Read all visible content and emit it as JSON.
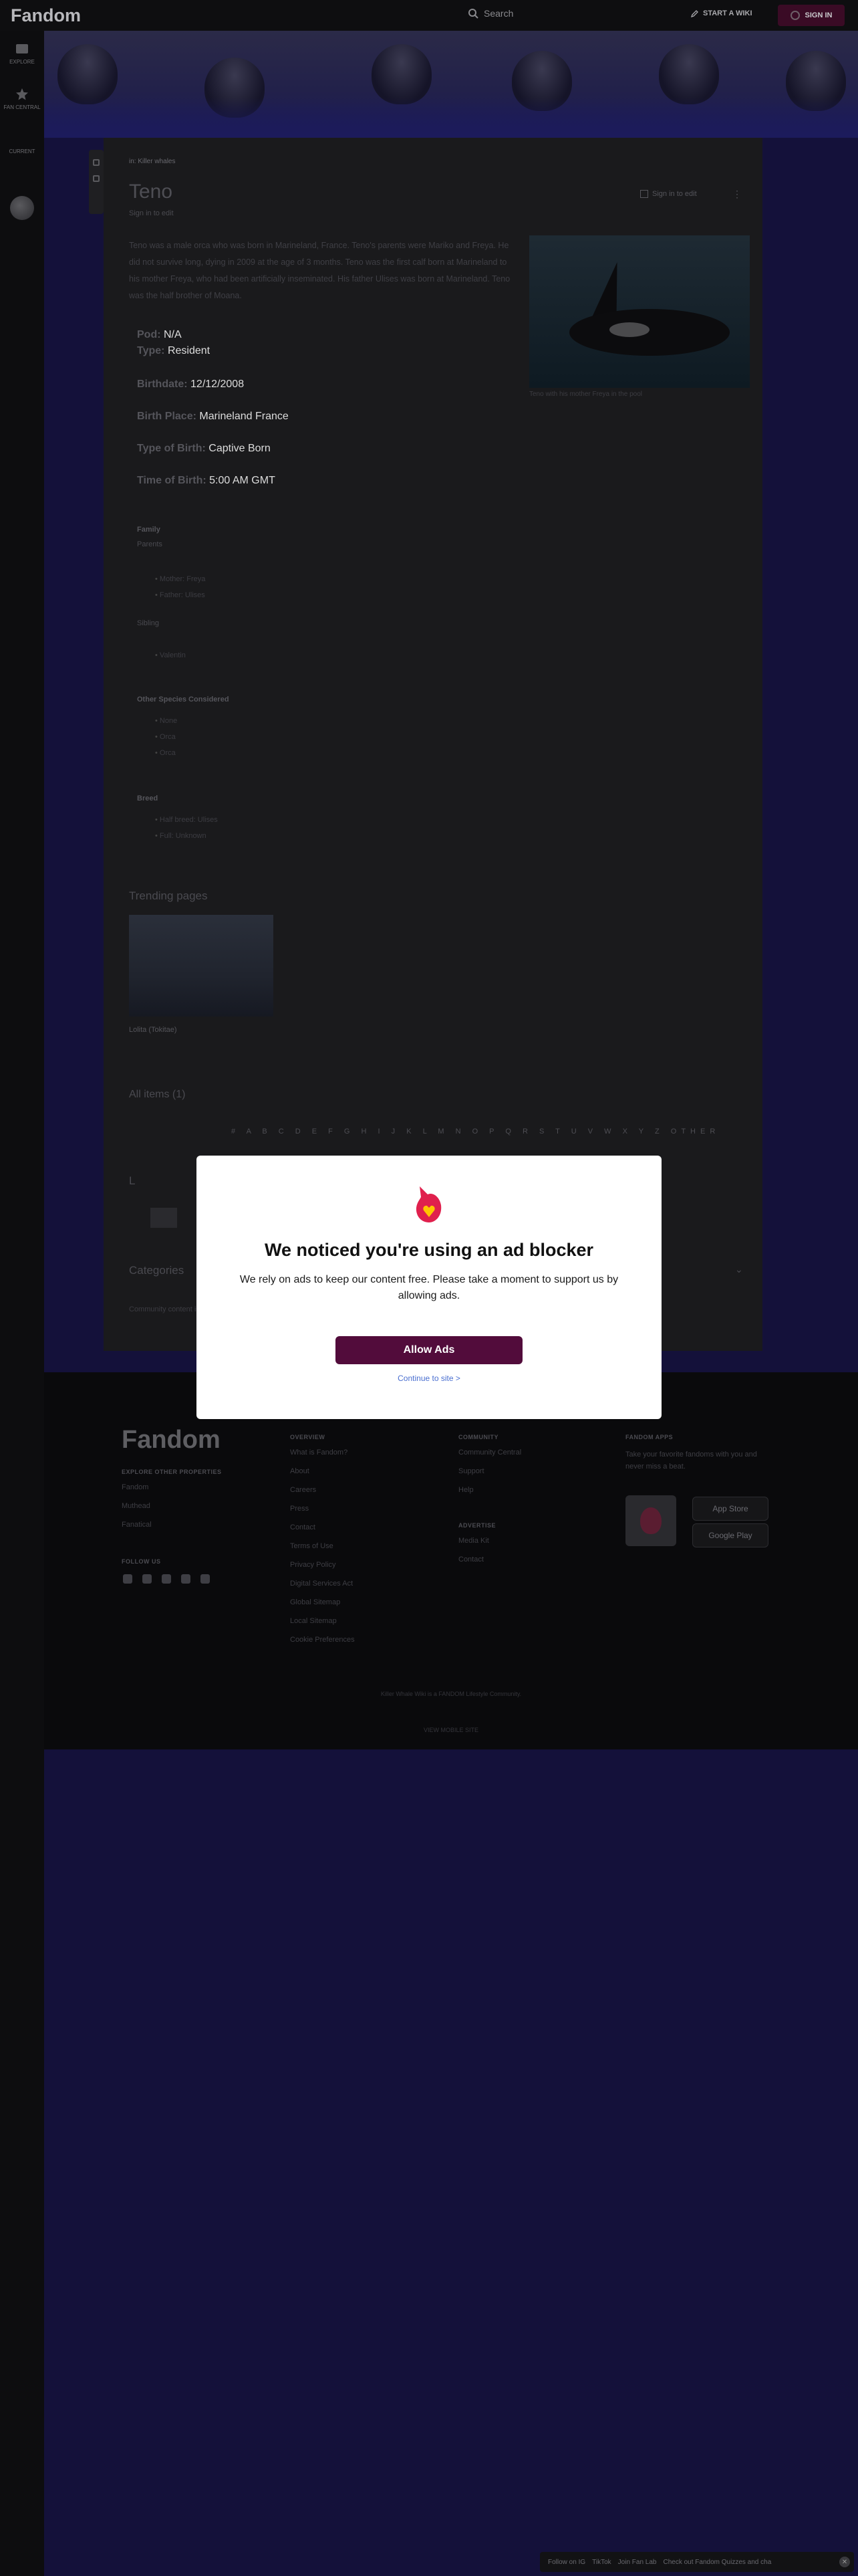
{
  "topbar": {
    "logo_text": "Fandom",
    "search_label": "Search",
    "start_wiki": "START A WIKI",
    "sign_in": "SIGN IN"
  },
  "rail": {
    "items": [
      {
        "label": "EXPLORE",
        "icon": "compass-icon"
      },
      {
        "label": "FAN CENTRAL",
        "icon": "star-icon"
      },
      {
        "label": "CURRENT",
        "icon": "avatar"
      }
    ]
  },
  "article": {
    "breadcrumb": "in: Killer whales",
    "title": "Teno",
    "subtitle": "Sign in to edit",
    "edit_label": "Sign in to edit",
    "intro": "Teno was a male orca who was born in Marineland, France. Teno's parents were Mariko and Freya. He did not survive long, dying in 2009 at the age of 3 months. Teno was the first calf born at Marineland to his mother Freya, who had been artificially inseminated. His father Ulises was born at Marineland. Teno was the half brother of Moana.",
    "image_caption": "Teno with his mother Freya in the pool",
    "facts": [
      {
        "label": "Pod:",
        "value": "N/A"
      },
      {
        "label": "Type:",
        "value": "Resident"
      },
      {
        "label": "Birthdate:",
        "value": "12/12/2008"
      },
      {
        "label": "Birth Place:",
        "value": "Marineland France"
      },
      {
        "label": "Type of Birth:",
        "value": "Captive Born"
      },
      {
        "label": "Time of Birth:",
        "value": "5:00 AM GMT"
      }
    ],
    "family_head": "Family",
    "parents_head": "Parents",
    "parents": [
      "Mother: Freya",
      "Father: Ulises"
    ],
    "siblings_head": "Sibling",
    "siblings": [
      "Valentin"
    ],
    "other_head": "Other Species Considered",
    "other": [
      "None",
      "Orca",
      "Orca"
    ],
    "breed_head": "Breed",
    "breed": [
      "Half breed: Ulises",
      "Full: Unknown"
    ]
  },
  "trending": {
    "title": "Trending pages",
    "card_label": "Lolita (Tokitae)"
  },
  "all_items": {
    "title": "All items (1)",
    "alphabet": "# A B C D E F G H I J K L M N O P Q R S T U V W X Y Z OTHER",
    "letter": "L"
  },
  "categories": {
    "title": "Categories",
    "community": "Community content is available under CC-BY-SA unless otherwise noted."
  },
  "footer": {
    "logo": "Fandom",
    "col1_title": "EXPLORE OTHER PROPERTIES",
    "col1": [
      "Fandom",
      "Muthead",
      "Fanatical"
    ],
    "follow_title": "FOLLOW US",
    "col2_title": "OVERVIEW",
    "col2": [
      "What is Fandom?",
      "About",
      "Careers",
      "Press",
      "Contact",
      "Terms of Use",
      "Privacy Policy",
      "Digital Services Act",
      "Global Sitemap",
      "Local Sitemap",
      "Cookie Preferences"
    ],
    "col3_title": "COMMUNITY",
    "col3": [
      "Community Central",
      "Support",
      "Help"
    ],
    "col4_title": "ADVERTISE",
    "col4": [
      "Media Kit",
      "Contact"
    ],
    "col5_title": "FANDOM APPS",
    "col5_text": "Take your favorite fandoms with you and never miss a beat.",
    "app_store": "App Store",
    "google_play": "Google Play",
    "small1": "Killer Whale Wiki is a FANDOM Lifestyle Community.",
    "small2": "VIEW MOBILE SITE"
  },
  "modal": {
    "title": "We noticed you're using an ad blocker",
    "text": "We rely on ads to keep our content free. Please take a moment to support us by allowing ads.",
    "allow": "Allow Ads",
    "continue": "Continue to site >"
  },
  "bottom_bar": {
    "items": [
      "Follow on IG",
      "TikTok",
      "Join Fan Lab",
      "Check out Fandom Quizzes and cha"
    ]
  },
  "colors": {
    "accent": "#520c3b",
    "brand_red": "#e0204d",
    "link": "#4a6fd0"
  }
}
